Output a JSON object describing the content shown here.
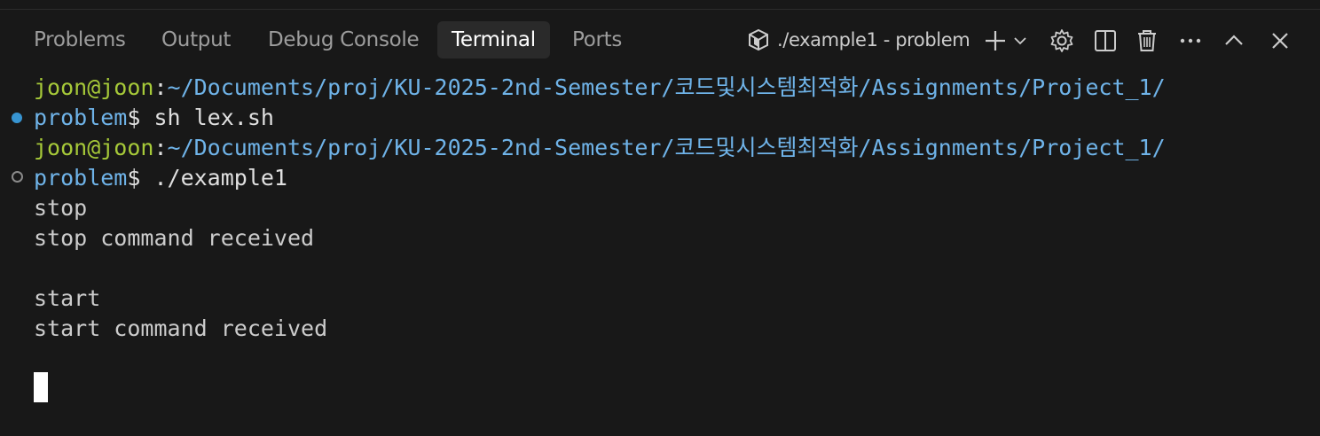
{
  "panel": {
    "tabs": [
      {
        "label": "Problems"
      },
      {
        "label": "Output"
      },
      {
        "label": "Debug Console"
      },
      {
        "label": "Terminal",
        "active": true
      },
      {
        "label": "Ports"
      }
    ],
    "terminal_title": "./example1 - problem",
    "actions": [
      "plus-icon",
      "chevron-down-icon",
      "gear-icon",
      "split-icon",
      "trash-icon",
      "ellipsis-icon",
      "chevron-up-icon",
      "close-icon"
    ]
  },
  "terminal": {
    "prompt1": {
      "user": "joon@joon",
      "sep": ":",
      "path": "~/Documents/proj/KU-2025-2nd-Semester/코드및시스템최적화/Assignments/Project_1/",
      "path_cont": "problem",
      "dollar": "$ ",
      "command": "sh lex.sh"
    },
    "prompt2": {
      "user": "joon@joon",
      "sep": ":",
      "path": "~/Documents/proj/KU-2025-2nd-Semester/코드및시스템최적화/Assignments/Project_1/",
      "path_cont": "problem",
      "dollar": "$ ",
      "command": "./example1"
    },
    "output": [
      "stop",
      "stop command received",
      "",
      "start",
      "start command received"
    ]
  },
  "colors": {
    "background": "#181818",
    "user": "#a6c939",
    "path": "#6fb3e8",
    "success_dot": "#3794d1"
  }
}
